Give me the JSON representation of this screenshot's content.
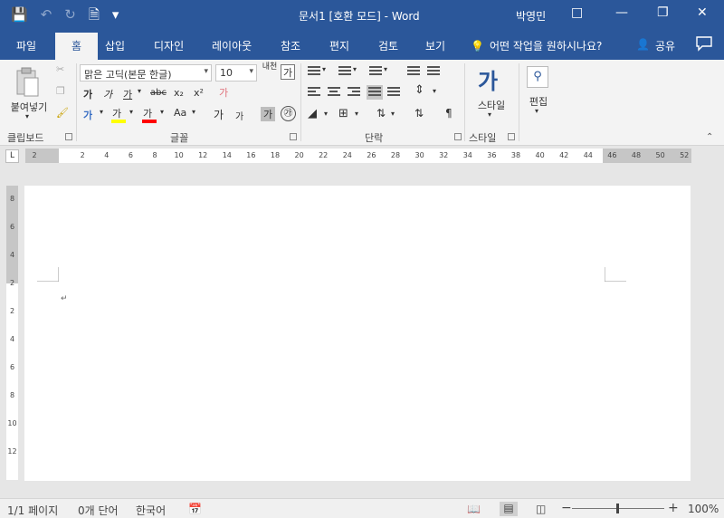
{
  "window": {
    "title": "문서1 [호환 모드] - Word",
    "user": "박영민"
  },
  "qat": {
    "save_icon": "save-icon",
    "undo_icon": "undo-icon",
    "redo_icon": "redo-icon",
    "new_icon": "new-document-icon",
    "more": "▾"
  },
  "tabs": [
    "파일",
    "홈",
    "삽입",
    "디자인",
    "레이아웃",
    "참조",
    "편지",
    "검토",
    "보기"
  ],
  "tell_me": "어떤 작업을 원하시나요?",
  "share": "공유",
  "ribbon": {
    "clipboard": {
      "paste": "붙여넣기",
      "label": "클립보드"
    },
    "font": {
      "face": "맑은 고딕(본문 한글)",
      "size": "10",
      "label": "글꼴",
      "bold": "가",
      "italic": "가",
      "underline": "가",
      "strike": "abc",
      "sub": "x₂",
      "sup": "x²",
      "case": "Aa",
      "grow": "가",
      "shrink": "가",
      "char_border": "가",
      "enclosed": "㉮",
      "phonetic": "내천",
      "clear": "가",
      "highlight": "가",
      "color": "가"
    },
    "paragraph": {
      "label": "단락"
    },
    "styles": {
      "button": "스타일",
      "label": "스타일",
      "icon_text": "가"
    },
    "editing": {
      "button": "편집"
    }
  },
  "ruler": {
    "h_ticks": [
      "2",
      "2",
      "4",
      "6",
      "8",
      "10",
      "12",
      "14",
      "16",
      "18",
      "20",
      "22",
      "24",
      "26",
      "28",
      "30",
      "32",
      "34",
      "36",
      "38",
      "40",
      "42",
      "44",
      "46",
      "48",
      "50",
      "52"
    ],
    "v_ticks": [
      "8",
      "6",
      "4",
      "2",
      "2",
      "4",
      "6",
      "8",
      "10",
      "12"
    ]
  },
  "status": {
    "page": "1/1 페이지",
    "words": "0개 단어",
    "language": "한국어",
    "zoom": "100%"
  },
  "colors": {
    "accent": "#2b579a",
    "highlight": "#ffff00",
    "font_color": "#ff0000"
  }
}
